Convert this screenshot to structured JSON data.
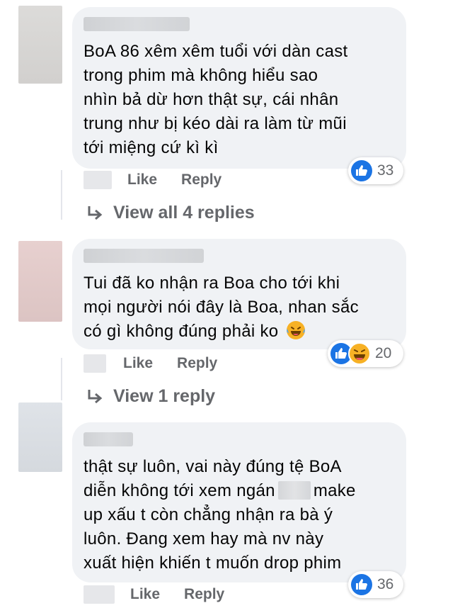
{
  "colors": {
    "bubble": "#f0f2f5",
    "secondary_text": "#65676b",
    "like_blue": "#1b74e4",
    "haha_yellow": "#f7b125"
  },
  "actions": {
    "like": "Like",
    "reply": "Reply"
  },
  "comments": [
    {
      "lines": [
        "BoA 86 xêm xêm tuổi với dàn cast",
        "trong phim mà không hiểu sao",
        "nhìn bả dừ hơn thật sự, cái nhân",
        "trung như bị kéo dài ra làm từ mũi",
        "tới miệng cứ kì kì"
      ],
      "reactions": [
        "like"
      ],
      "reaction_count": "33",
      "view_replies": "View all 4 replies"
    },
    {
      "lines": [
        "Tui đã ko nhận ra Boa cho tới khi",
        "mọi người nói đây là Boa, nhan sắc",
        "có gì không đúng phải ko"
      ],
      "trailing_emoji": "laughing-tears-emoji",
      "reactions": [
        "like",
        "haha"
      ],
      "reaction_count": "20",
      "view_replies": "View 1 reply"
    },
    {
      "lines": [
        "thật sự luôn, vai này đúng tệ BoA",
        "diễn không tới xem ngán",
        "make",
        "up xấu t còn chẳng nhận ra bà ý",
        "luôn. Đang xem hay mà nv này",
        "xuất hiện khiến t muốn drop phim"
      ],
      "reactions": [
        "like"
      ],
      "reaction_count": "36"
    }
  ]
}
